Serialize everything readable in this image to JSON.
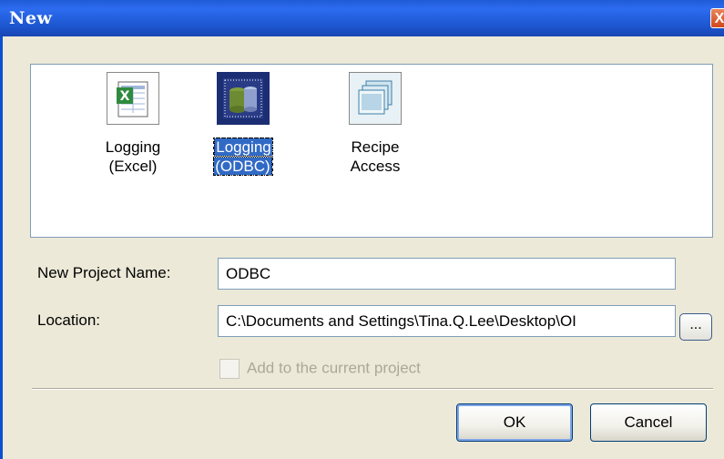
{
  "window": {
    "title": "New",
    "close_glyph": "X"
  },
  "templates": [
    {
      "label_line1": "Logging",
      "label_line2": "(Excel)",
      "icon": "excel-sheet-icon",
      "selected": false
    },
    {
      "label_line1": "Logging",
      "label_line2": "(ODBC)",
      "icon": "database-icon",
      "selected": true
    },
    {
      "label_line1": "Recipe",
      "label_line2": "Access",
      "icon": "stacked-windows-icon",
      "selected": false
    }
  ],
  "form": {
    "project_name_label": "New Project Name:",
    "project_name_value": "ODBC",
    "location_label": "Location:",
    "location_value": "C:\\Documents and Settings\\Tina.Q.Lee\\Desktop\\OI",
    "browse_label": "...",
    "add_to_project_label": "Add to the current project",
    "add_to_project_checked": false,
    "add_to_project_enabled": false
  },
  "buttons": {
    "ok": "OK",
    "cancel": "Cancel"
  },
  "colors": {
    "titlebar": "#2d6cf0",
    "selection": "#316ac5",
    "dialog_bg": "#ece9d8"
  }
}
